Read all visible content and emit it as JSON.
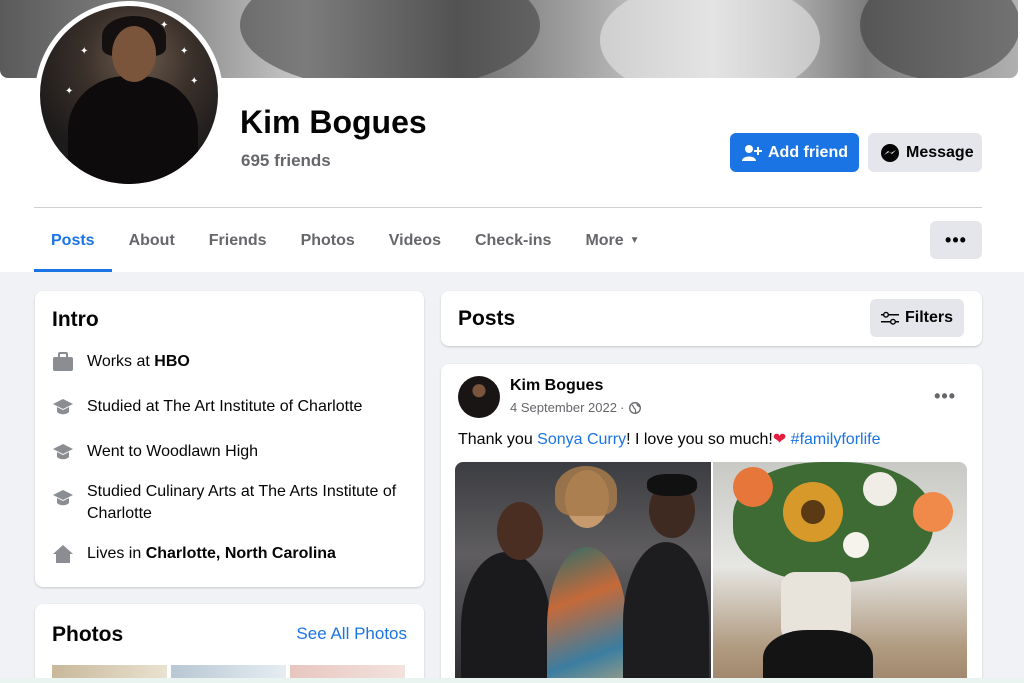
{
  "profile": {
    "name": "Kim Bogues",
    "friends_count": "695 friends"
  },
  "actions": {
    "add_friend": "Add friend",
    "message": "Message"
  },
  "tabs": [
    {
      "label": "Posts",
      "active": true
    },
    {
      "label": "About"
    },
    {
      "label": "Friends"
    },
    {
      "label": "Photos"
    },
    {
      "label": "Videos"
    },
    {
      "label": "Check-ins"
    },
    {
      "label": "More"
    }
  ],
  "intro": {
    "title": "Intro",
    "items": [
      {
        "icon": "briefcase-icon",
        "prefix": "Works at ",
        "bold": "HBO"
      },
      {
        "icon": "graduation-cap-icon",
        "prefix": "Studied at The Art Institute of Charlotte",
        "bold": ""
      },
      {
        "icon": "graduation-cap-icon",
        "prefix": "Went to Woodlawn High",
        "bold": ""
      },
      {
        "icon": "graduation-cap-icon",
        "prefix": "Studied Culinary Arts at The Arts Institute of Charlotte",
        "bold": ""
      },
      {
        "icon": "home-icon",
        "prefix": "Lives in ",
        "bold": "Charlotte, North Carolina"
      }
    ]
  },
  "photos": {
    "title": "Photos",
    "see_all": "See All Photos"
  },
  "posts_section": {
    "title": "Posts",
    "filters_label": "Filters"
  },
  "post": {
    "author": "Kim Bogues",
    "date": "4 September 2022",
    "text_before": "Thank you ",
    "mention": "Sonya Curry",
    "text_after": "! I love you so much!",
    "hashtag": "#familyforlife"
  },
  "colors": {
    "accent": "#1b74e4",
    "background": "#f0f2f5",
    "secondary_text": "#65676b"
  }
}
